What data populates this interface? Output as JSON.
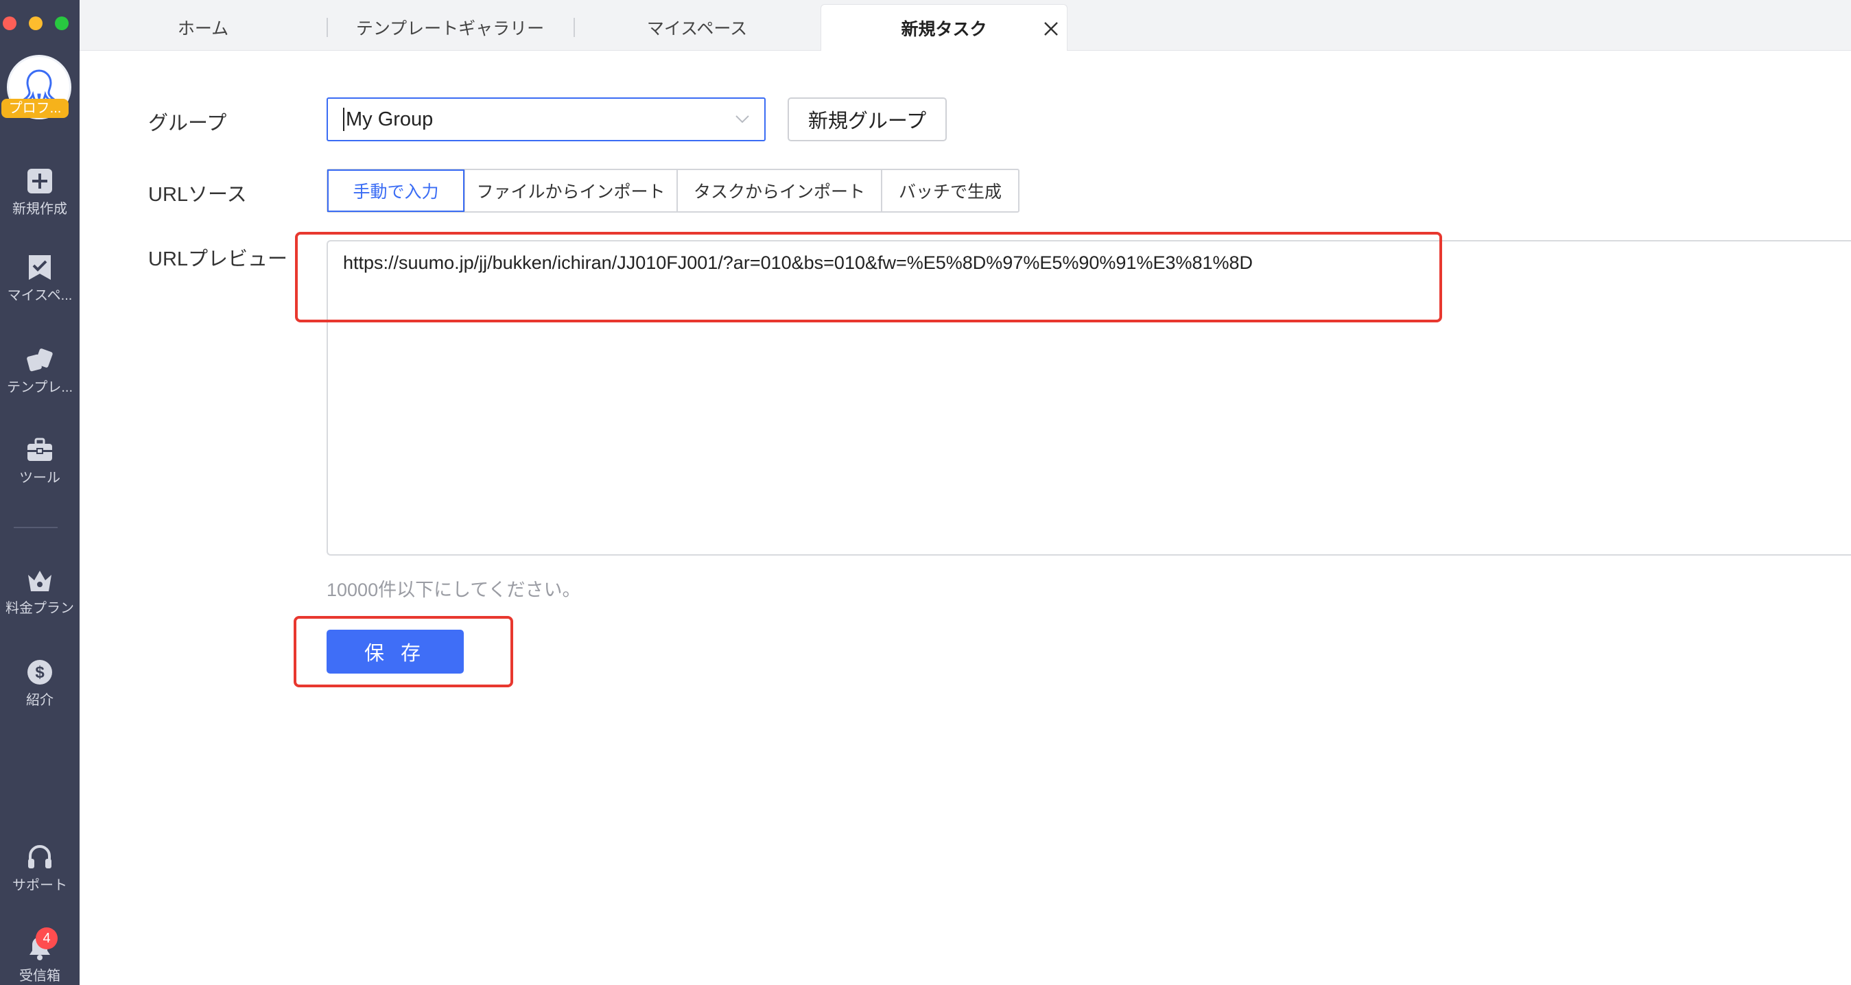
{
  "sidebar": {
    "avatar_label": "プロフ...",
    "items": [
      {
        "label": "新規作成",
        "icon": "plus-square-icon"
      },
      {
        "label": "マイスペ...",
        "icon": "bookmark-check-icon"
      },
      {
        "label": "テンプレ...",
        "icon": "template-icon"
      },
      {
        "label": "ツール",
        "icon": "toolbox-icon"
      },
      {
        "label": "料金プラン",
        "icon": "crown-icon"
      },
      {
        "label": "紹介",
        "icon": "dollar-icon"
      },
      {
        "label": "サポート",
        "icon": "headset-icon"
      },
      {
        "label": "受信箱",
        "icon": "bell-icon"
      }
    ],
    "notification_count": "4"
  },
  "tabs": [
    {
      "label": "ホーム"
    },
    {
      "label": "テンプレートギャラリー"
    },
    {
      "label": "マイスペース"
    },
    {
      "label": "新規タスク",
      "active": true
    }
  ],
  "form": {
    "group_label": "グループ",
    "group_value": "My Group",
    "new_group_button": "新規グループ",
    "url_source_label": "URLソース",
    "url_source_options": [
      "手動で入力",
      "ファイルからインポート",
      "タスクからインポート",
      "バッチで生成"
    ],
    "url_source_selected": "手動で入力",
    "url_preview_label": "URLプレビュー",
    "url_preview_value": "https://suumo.jp/jj/bukken/ichiran/JJ010FJ001/?ar=010&bs=010&fw=%E5%8D%97%E5%90%91%E3%81%8D",
    "hint": "10000件以下にしてください。",
    "save_button": "保 存"
  },
  "colors": {
    "sidebar_bg": "#3c4157",
    "accent": "#3f6ef7",
    "annotation": "#e8382f"
  }
}
